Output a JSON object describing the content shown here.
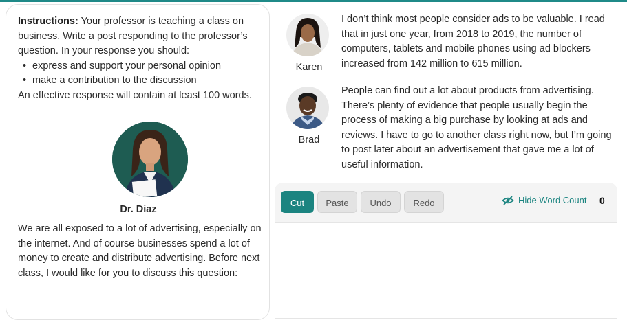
{
  "instructions": {
    "label": "Instructions:",
    "text": " Your professor is teaching a class on business. Write a post responding to the professor’s question. In your response you should:",
    "bullets": [
      "express and support your personal opinion",
      "make a contribution to the discussion"
    ],
    "closing": "An effective response will contain at least 100 words."
  },
  "professor": {
    "name": "Dr. Diaz",
    "text": "We are all exposed to a lot of advertising, especially on the internet. And of course businesses spend a lot of money to create and distribute advertising. Before next class, I would like for you to discuss this question:"
  },
  "posts": [
    {
      "name": "Karen",
      "text": "I don’t think most people consider ads to be valuable. I read that in just one year, from 2018 to 2019, the number of computers, tablets and mobile phones using ad blockers increased from 142 million to 615 million."
    },
    {
      "name": "Brad",
      "text": "People can find out a lot about products from advertising. There’s plenty of evidence that people usually begin the process of making a big purchase by looking at ads and reviews. I have to go to another class right now, but I’m going to post later about an advertisement that gave me a lot of useful information."
    }
  ],
  "editor": {
    "buttons": {
      "cut": "Cut",
      "paste": "Paste",
      "undo": "Undo",
      "redo": "Redo"
    },
    "hide_word_count": "Hide Word Count",
    "word_count": "0",
    "response_value": ""
  },
  "colors": {
    "accent": "#1b8480",
    "topline": "#1f8a88"
  },
  "icons": {
    "word_count_toggle": "eye-slash-icon"
  }
}
